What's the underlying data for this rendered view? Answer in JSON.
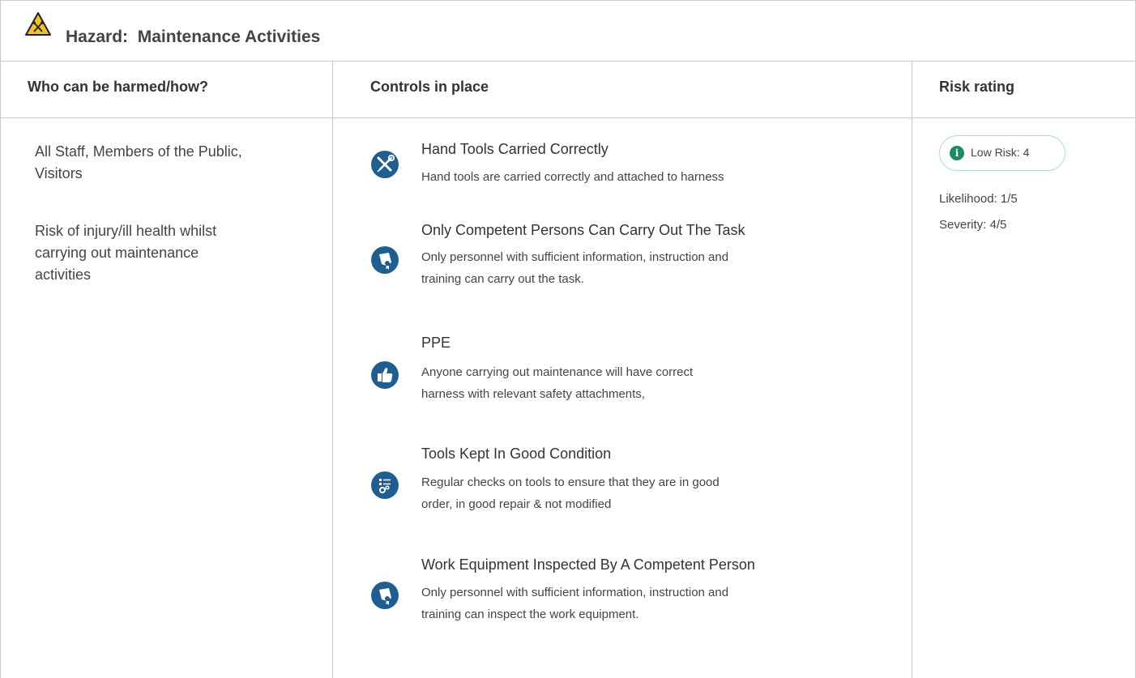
{
  "hazard": {
    "prefix": "Hazard:",
    "name": "Maintenance Activities",
    "icon": "warning-triangle-icon"
  },
  "columns": {
    "who": "Who can be harmed/how?",
    "controls": "Controls in place",
    "risk": "Risk rating"
  },
  "harm": {
    "who_line1": "All Staff, Members of the Public,",
    "who_line2": "Visitors",
    "how_line1": "Risk of injury/ill health whilst",
    "how_line2": "carrying out maintenance",
    "how_line3": "activities"
  },
  "controls": [
    {
      "title": "Hand Tools Carried Correctly",
      "desc_line1": "Hand tools are carried correctly and attached to harness",
      "desc_line2": "",
      "icon": "tools-icon"
    },
    {
      "title": "Only Competent Persons Can Carry Out The Task",
      "desc_line1": "Only personnel with sufficient information, instruction and",
      "desc_line2": "training can carry out the task.",
      "icon": "certificate-icon"
    },
    {
      "title": "PPE",
      "desc_line1": "Anyone carrying out maintenance will have correct",
      "desc_line2": "harness with relevant safety attachments,",
      "icon": "thumbs-up-icon"
    },
    {
      "title": "Tools Kept In Good Condition",
      "desc_line1": "Regular checks on tools to ensure that they are in good",
      "desc_line2": "order, in good repair & not modified",
      "icon": "checklist-gear-icon"
    },
    {
      "title": "Work Equipment Inspected By A Competent Person",
      "desc_line1": "Only personnel with sufficient information, instruction and",
      "desc_line2": "training can inspect the work equipment.",
      "icon": "certificate-icon"
    }
  ],
  "risk": {
    "badge": "Low Risk: 4",
    "likelihood": "Likelihood: 1/5",
    "severity": "Severity: 4/5",
    "color": "#1d8a64"
  }
}
